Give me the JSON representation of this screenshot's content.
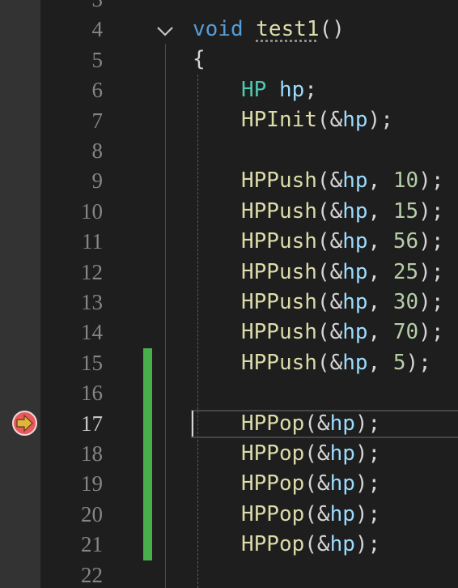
{
  "editor": {
    "line_numbers": [
      "3",
      "4",
      "5",
      "6",
      "7",
      "8",
      "9",
      "10",
      "11",
      "12",
      "13",
      "14",
      "15",
      "16",
      "17",
      "18",
      "19",
      "20",
      "21",
      "22"
    ],
    "current_line": "17",
    "function_keyword": "void",
    "function_name": "test1",
    "function_params": "()",
    "open_brace": "{",
    "type_name": "HP",
    "var_name": "hp",
    "semicolon": ";",
    "init_call": "HPInit",
    "push_call": "HPPush",
    "pop_call": "HPPop",
    "open_paren_amp": "(&",
    "close_paren_semi": ");",
    "comma_space": ", ",
    "push_values": [
      "10",
      "15",
      "56",
      "25",
      "30",
      "70",
      "5"
    ],
    "colors": {
      "background": "#1e1e1e",
      "gutter": "#333333",
      "change_bar": "#48b04b",
      "breakpoint_arrow": "#e2b53a",
      "breakpoint_ring": "#e8595e"
    },
    "icons": [
      "chevron-down-icon",
      "breakpoint-current-statement-icon"
    ]
  }
}
